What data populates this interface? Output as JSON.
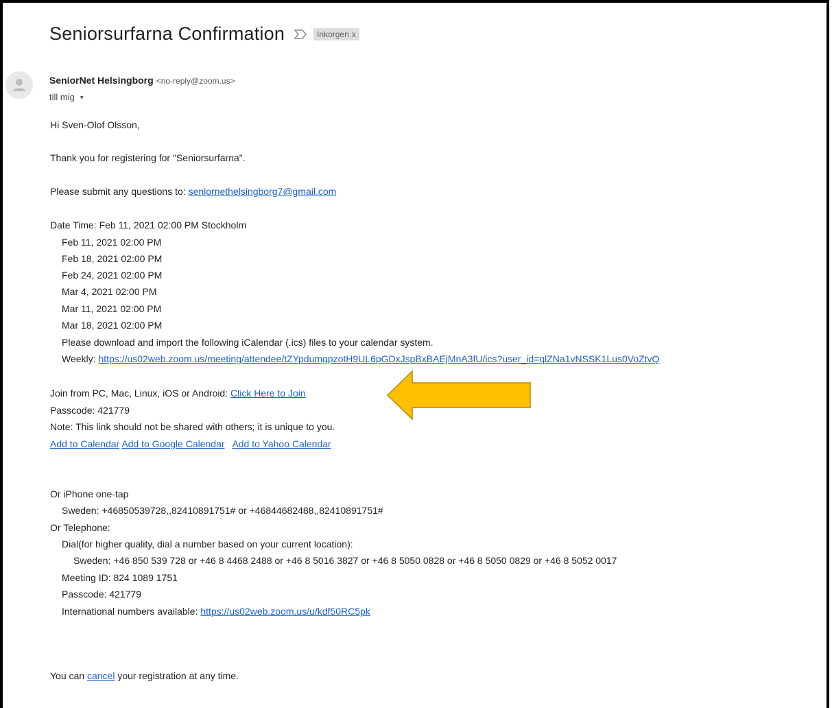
{
  "subject": {
    "title": "Seniorsurfarna Confirmation",
    "importance_icon": "importance-marker-icon",
    "label": "Inkorgen",
    "label_remove": "x"
  },
  "sender": {
    "avatar_icon": "person-avatar-icon",
    "name": "SeniorNet Helsingborg",
    "email": "<no-reply@zoom.us>",
    "to": "till mig",
    "to_caret_icon": "caret-down-icon"
  },
  "email_body": {
    "greeting": "Hi Sven-Olof Olsson,",
    "thanks": "Thank you for registering for \"Seniorsurfarna\".",
    "questions_prefix": "Please submit any questions to: ",
    "questions_email": "seniornethelsingborg7@gmail.com",
    "datetime": "Date Time: Feb 11, 2021 02:00 PM Stockholm",
    "occurrences": [
      "Feb 11, 2021 02:00 PM",
      "Feb 18, 2021 02:00 PM",
      "Feb 24, 2021 02:00 PM",
      "Mar 4, 2021 02:00 PM",
      "Mar 11, 2021 02:00 PM",
      "Mar 18, 2021 02:00 PM"
    ],
    "ics_note": "Please download and import the following iCalendar (.ics) files to your calendar system.",
    "weekly_prefix": "Weekly: ",
    "weekly_link": "https://us02web.zoom.us/meeting/attendee/tZYpdumgpzotH9UL6pGDxJspBxBAEjMnA3fU/ics?user_id=qlZNa1vNSSK1Lus0VoZtvQ",
    "join_prefix": "Join from PC, Mac, Linux, iOS or Android: ",
    "join_link": "Click Here to Join",
    "passcode": "Passcode: 421779",
    "note": "Note: This link should not be shared with others; it is unique to you.",
    "add_calendar": "Add to Calendar",
    "add_google": "Add to Google Calendar",
    "add_yahoo": "Add to Yahoo Calendar",
    "iphone_header": "Or iPhone one-tap",
    "iphone_sweden": "Sweden: +46850539728,,82410891751# or +46844682488,,82410891751#",
    "telephone_header": "Or Telephone:",
    "dial_note": "Dial(for higher quality, dial a number based on your current location):",
    "dial_sweden": "Sweden: +46 850 539 728 or +46 8 4468 2488 or +46 8 5016 3827 or +46 8 5050 0828 or +46 8 5050 0829 or +46 8 5052 0017",
    "meeting_id": "Meeting ID: 824 1089 1751",
    "passcode2": "Passcode: 421779",
    "intl_prefix": "International numbers available: ",
    "intl_link": "https://us02web.zoom.us/u/kdf50RC5pk",
    "cancel_prefix": "You can ",
    "cancel_link": "cancel",
    "cancel_suffix": " your registration at any time."
  },
  "annotation": {
    "arrow_icon": "arrow-left-icon",
    "arrow_color": "#ffc000",
    "arrow_outline": "#b8860b"
  },
  "colors": {
    "link": "#1a5fd6",
    "text": "#222222"
  }
}
